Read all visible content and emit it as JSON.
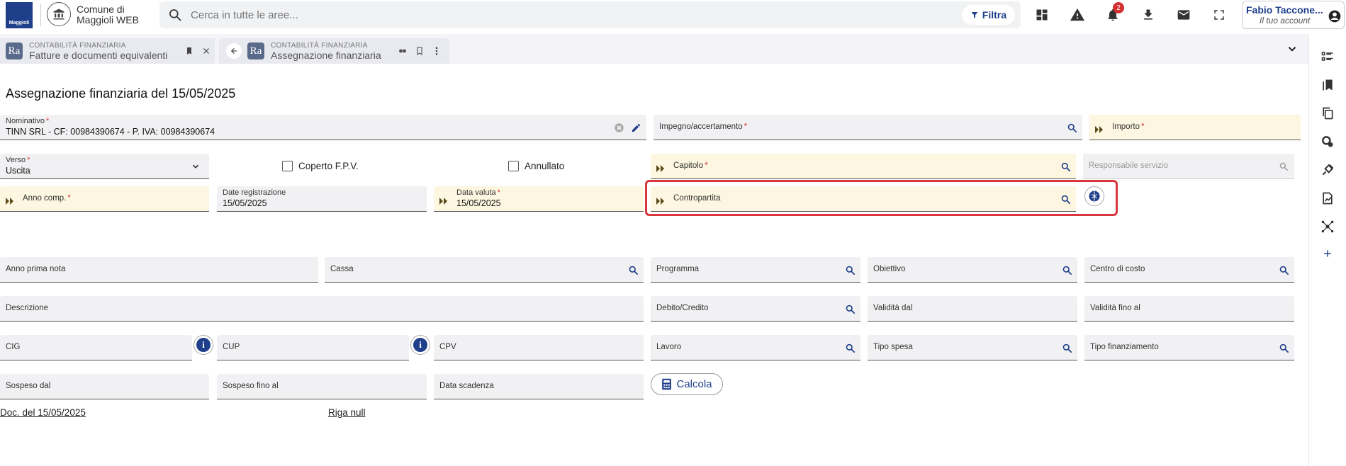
{
  "app": {
    "brand_top": "GRUPPO",
    "brand": "Maggioli",
    "name_line1": "Comune di",
    "name_line2": "Maggioli WEB"
  },
  "search": {
    "placeholder": "Cerca in tutte le aree...",
    "filter_label": "Filtra"
  },
  "toolbar": {
    "notifications_count": "2"
  },
  "user": {
    "name": "Fabio Taccone...",
    "account_label": "Il tuo account"
  },
  "tabs": [
    {
      "section": "CONTABILITÀ FINANZIARIA",
      "title": "Fatture e documenti equivalenti",
      "icon": "Ra"
    },
    {
      "section": "CONTABILITÀ FINANZIARIA",
      "title": "Assegnazione finanziaria",
      "icon": "Ra"
    }
  ],
  "page": {
    "title": "Assegnazione finanziaria del 15/05/2025"
  },
  "form": {
    "nominativo": {
      "label": "Nominativo",
      "value": "TINN SRL - CF: 00984390674 - P. IVA: 00984390674"
    },
    "impegno": {
      "label": "Impegno/accertamento"
    },
    "importo": {
      "label": "Importo"
    },
    "verso": {
      "label": "Verso",
      "value": "Uscita"
    },
    "coperto": {
      "label": "Coperto F.P.V."
    },
    "annullato": {
      "label": "Annullato"
    },
    "capitolo": {
      "label": "Capitolo"
    },
    "responsabile": {
      "label": "Responsabile servizio"
    },
    "anno_comp": {
      "label": "Anno comp."
    },
    "data_reg": {
      "label": "Date registrazione",
      "value": "15/05/2025"
    },
    "data_valuta": {
      "label": "Data valuta",
      "value": "15/05/2025"
    },
    "contropartita": {
      "label": "Contropartita"
    },
    "anno_prima_nota": {
      "label": "Anno prima nota"
    },
    "cassa": {
      "label": "Cassa"
    },
    "programma": {
      "label": "Programma"
    },
    "obiettivo": {
      "label": "Obiettivo"
    },
    "centro_costo": {
      "label": "Centro di costo"
    },
    "descrizione": {
      "label": "Descrizione"
    },
    "debito_credito": {
      "label": "Debito/Credito"
    },
    "validita_dal": {
      "label": "Validità dal"
    },
    "validita_fino": {
      "label": "Validità fino al"
    },
    "cig": {
      "label": "CIG"
    },
    "cup": {
      "label": "CUP"
    },
    "cpv": {
      "label": "CPV"
    },
    "lavoro": {
      "label": "Lavoro"
    },
    "tipo_spesa": {
      "label": "Tipo spesa"
    },
    "tipo_fin": {
      "label": "Tipo finanziamento"
    },
    "sospeso_dal": {
      "label": "Sospeso dal"
    },
    "sospeso_fino": {
      "label": "Sospeso fino al"
    },
    "data_scadenza": {
      "label": "Data scadenza"
    },
    "calcola": {
      "label": "Calcola"
    }
  },
  "links": {
    "doc": "Doc. del 15/05/2025",
    "riga": "Riga null"
  },
  "colors": {
    "accent": "#1f3f8a",
    "required_bg": "#fdf6e0",
    "field_bg": "#f1f1f3",
    "highlight": "#d9363e",
    "badge": "#d32f2f"
  }
}
